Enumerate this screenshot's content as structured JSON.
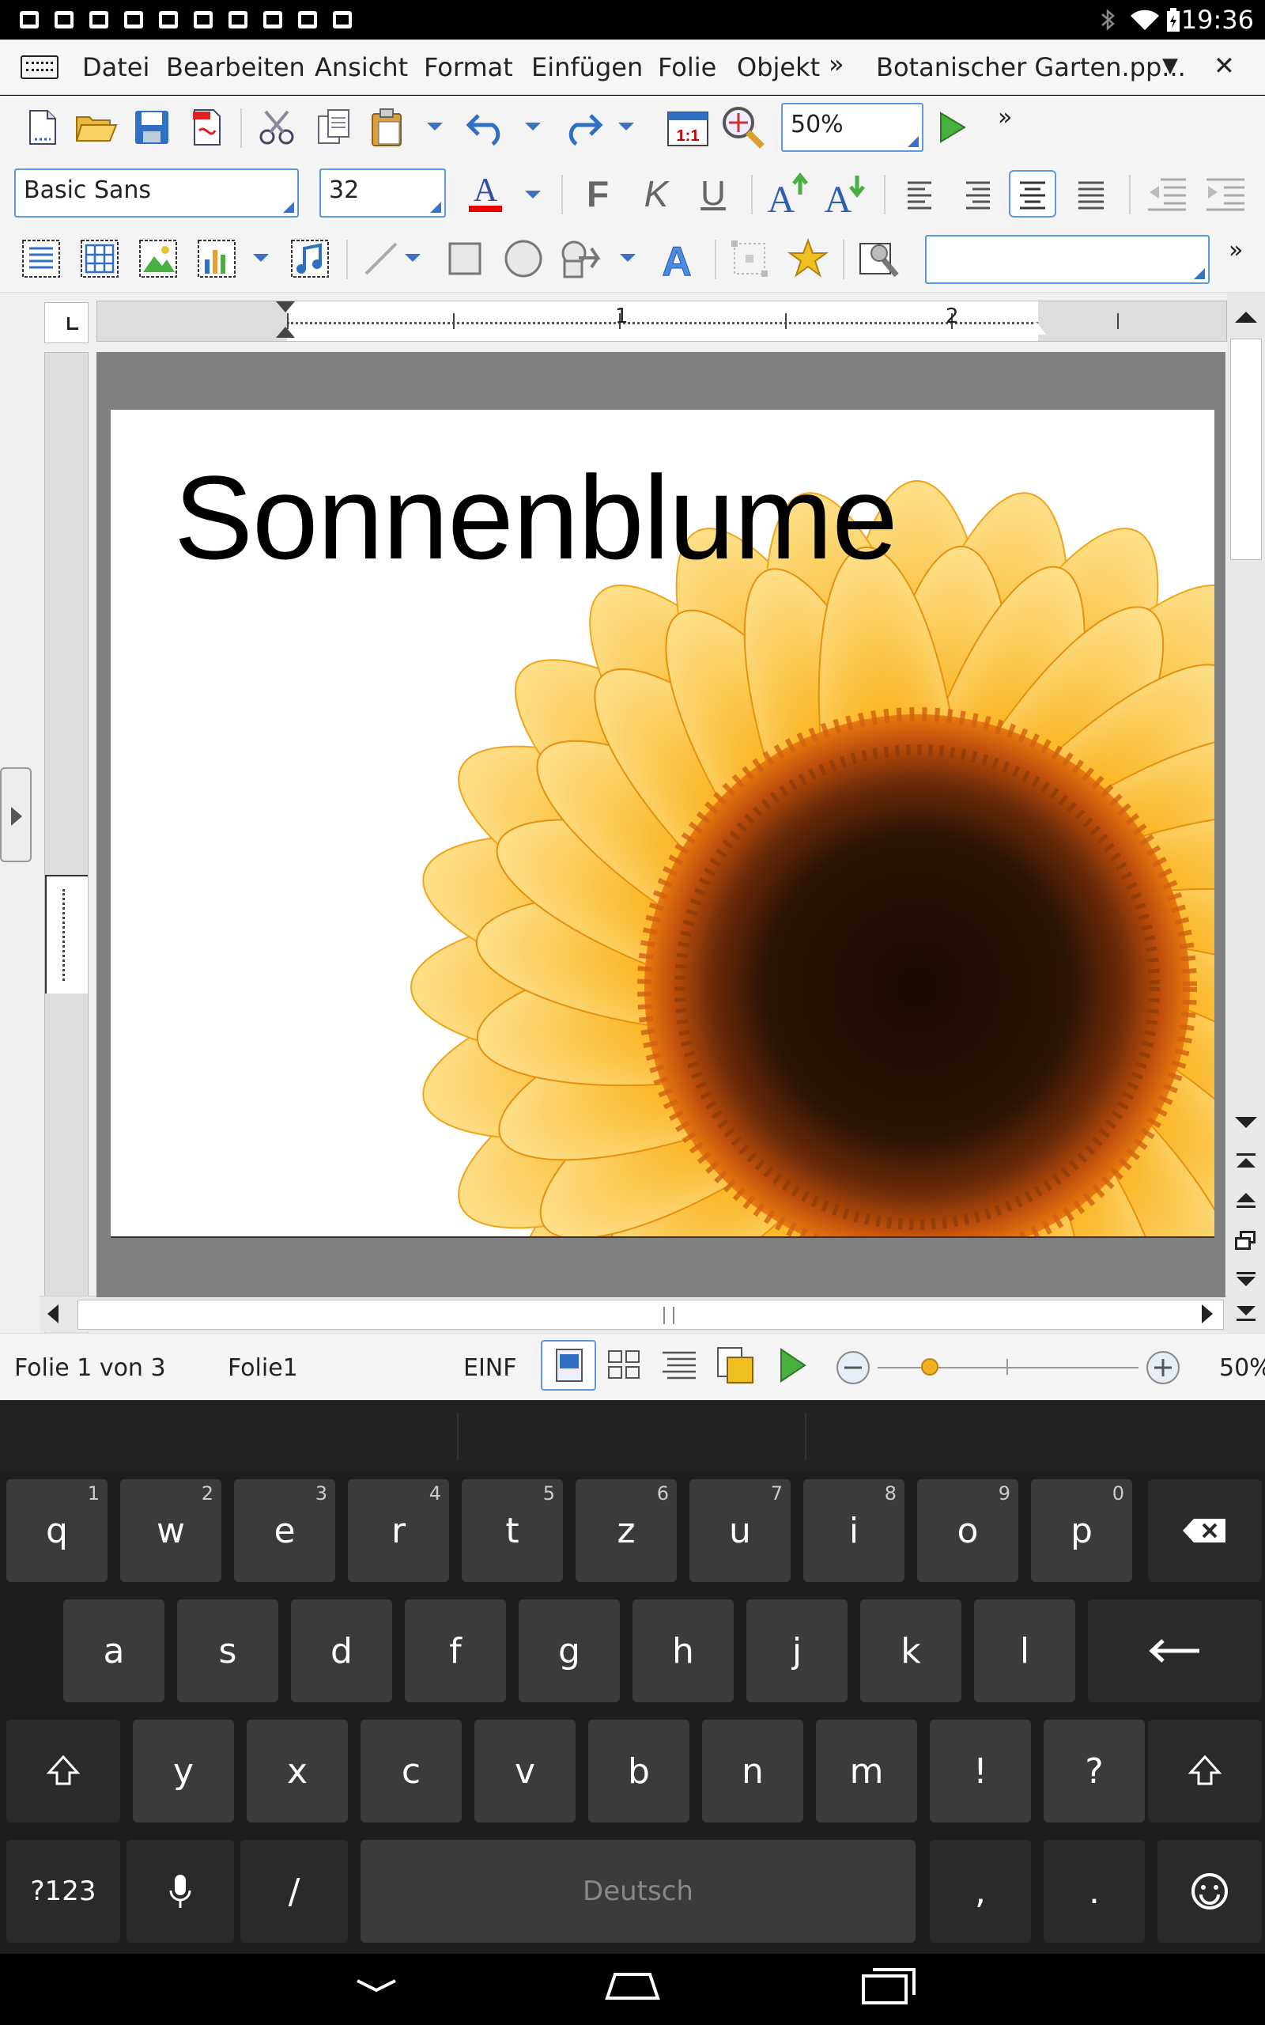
{
  "statusbar": {
    "time": "19:36",
    "left_icons": [
      "hangouts-icon",
      "keyboard-icon",
      "download-icon",
      "image-icon",
      "clipboard-icon",
      "gmail-icon",
      "clipboard-icon",
      "clipboard-icon",
      "briefcase-icon",
      "briefcase-icon"
    ],
    "right_icons": [
      "bluetooth-icon",
      "wifi-icon",
      "battery-icon"
    ]
  },
  "menubar": {
    "items": [
      "Datei",
      "Bearbeiten",
      "Ansicht",
      "Format",
      "Einfügen",
      "Folie",
      "Objekt"
    ],
    "more": "»",
    "document_title": "Botanischer Garten.pp...",
    "title_dropdown": "▼",
    "close": "✕"
  },
  "toolbar1": {
    "zoom_value": "50%",
    "more": "»"
  },
  "toolbar2": {
    "font_name": "Basic Sans",
    "font_size": "32",
    "bold": "F",
    "italic": "K",
    "underline": "U"
  },
  "toolbar3": {
    "style_value": "",
    "more": "»"
  },
  "ruler": {
    "ticks": [
      "1",
      "2"
    ]
  },
  "slide": {
    "title": "Sonnenblume"
  },
  "statusline": {
    "slide_position": "Folie 1 von 3",
    "slide_name": "Folie1",
    "insert_mode": "EINF",
    "zoom": "50%",
    "zoom_fraction": 0.2
  },
  "keyboard": {
    "row1": [
      {
        "label": "q",
        "hint": "1"
      },
      {
        "label": "w",
        "hint": "2"
      },
      {
        "label": "e",
        "hint": "3"
      },
      {
        "label": "r",
        "hint": "4"
      },
      {
        "label": "t",
        "hint": "5"
      },
      {
        "label": "z",
        "hint": "6"
      },
      {
        "label": "u",
        "hint": "7"
      },
      {
        "label": "i",
        "hint": "8"
      },
      {
        "label": "o",
        "hint": "9"
      },
      {
        "label": "p",
        "hint": "0"
      }
    ],
    "row2": [
      "a",
      "s",
      "d",
      "f",
      "g",
      "h",
      "j",
      "k",
      "l"
    ],
    "row3": [
      "y",
      "x",
      "c",
      "v",
      "b",
      "n",
      "m",
      "!",
      "?"
    ],
    "symbols_key": "?123",
    "slash_key": "/",
    "space_label": "Deutsch",
    "comma_key": ",",
    "period_key": "."
  }
}
